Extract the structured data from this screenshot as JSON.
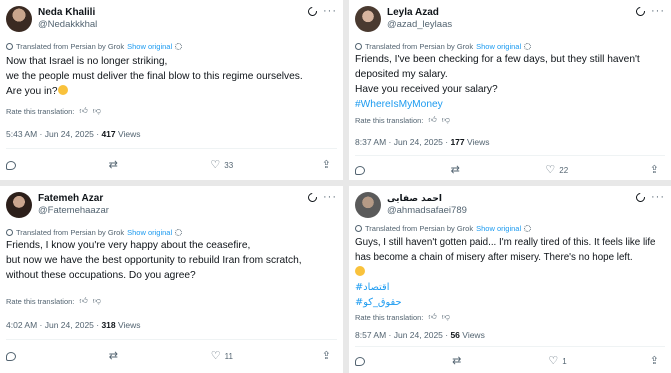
{
  "translation_prefix": "Translated from Persian by Grok",
  "show_original": "Show original",
  "rate_label": "Rate this translation:",
  "views_label": "Views",
  "tweets": [
    {
      "name": "Neda Khalili",
      "handle": "@Nedakkkhal",
      "lines": [
        "Now that Israel is no longer striking,",
        "we the people must deliver the final blow to this regime ourselves.",
        "Are you in?"
      ],
      "hashtags": [],
      "timestamp": "5:43 AM · Jun 24, 2025 · ",
      "views": "417",
      "replies": "",
      "retweets": "",
      "likes": "33"
    },
    {
      "name": "Leyla Azad",
      "handle": "@azad_leylaas",
      "lines": [
        "Friends, I've been checking for a few days, but they still haven't",
        "deposited my salary.",
        "Have you received your salary?"
      ],
      "hashtags": [
        "#WhereIsMyMoney"
      ],
      "timestamp": "8:37 AM · Jun 24, 2025 · ",
      "views": "177",
      "replies": "",
      "retweets": "",
      "likes": "22"
    },
    {
      "name": "Fatemeh Azar",
      "handle": "@Fatemehaazar",
      "lines": [
        "Friends, I know you're very happy about the ceasefire,",
        "but now we have the best opportunity to rebuild Iran from scratch,",
        "without these occupations. Do you agree?"
      ],
      "hashtags": [],
      "timestamp": "4:02 AM · Jun 24, 2025 · ",
      "views": "318",
      "replies": "",
      "retweets": "",
      "likes": "11"
    },
    {
      "name": "احمد صفایی",
      "handle": "@ahmadsafaei789",
      "lines": [
        "Guys, I still haven't gotten paid... I'm really tired of this. It feels like life",
        "has become a chain of misery after misery. There's no hope left."
      ],
      "hashtags": [
        "#اقتصاد",
        "#حقوق_کو"
      ],
      "timestamp": "8:57 AM · Jun 24, 2025 · ",
      "views": "56",
      "replies": "",
      "retweets": "",
      "likes": "1"
    }
  ],
  "icons": {
    "grok": "grok-icon",
    "more": "more-icon",
    "reply": "reply-icon",
    "retweet": "retweet-icon",
    "like": "heart-icon",
    "share": "share-icon",
    "thumb_up": "thumbs-up-icon",
    "thumb_down": "thumbs-down-icon"
  },
  "colors": {
    "link": "#1d9bf0",
    "muted": "#536471",
    "text": "#0f1419"
  }
}
